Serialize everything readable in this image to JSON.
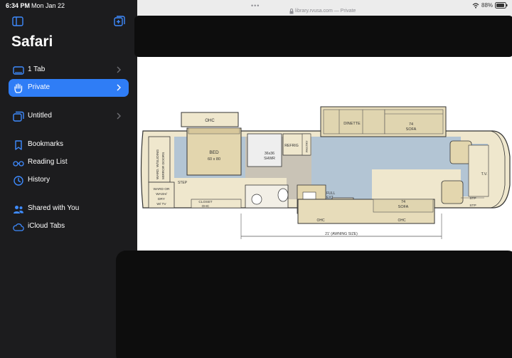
{
  "status": {
    "time": "6:34 PM",
    "date": "Mon Jan 22",
    "battery": "88%"
  },
  "sidebar": {
    "title": "Safari",
    "items": [
      {
        "label": "1 Tab",
        "icon": "tablet-icon"
      },
      {
        "label": "Private",
        "icon": "hand-icon"
      },
      {
        "label": "Untitled",
        "icon": "tab-group-icon"
      },
      {
        "label": "Bookmarks",
        "icon": "bookmark-icon"
      },
      {
        "label": "Reading List",
        "icon": "glasses-icon"
      },
      {
        "label": "History",
        "icon": "clock-icon"
      },
      {
        "label": "Shared with You",
        "icon": "people-icon"
      },
      {
        "label": "iCloud Tabs",
        "icon": "cloud-icon"
      }
    ]
  },
  "toolbar": {
    "url": "library.rvusa.com — Private",
    "dots": "•••"
  },
  "floorplan": {
    "ohc_top": "OHC",
    "bed": "BED",
    "bed_size": "60 x 80",
    "ward_mirror": [
      "WARD. W/SLIDING",
      "MIRROR DOORS"
    ],
    "ward_washer": [
      "WARD OR",
      "WASH/",
      "DRY",
      "W/ TV"
    ],
    "step_left": "STEP",
    "closet_ohc": [
      "CLOSET",
      "OHC"
    ],
    "shower": [
      "36x36",
      "SHWR"
    ],
    "refrig": "REFRIG",
    "pantry": "PANTRY",
    "dinette": "DINETTE",
    "sofa_top": [
      "74",
      "SOFA"
    ],
    "sofa_bottom": [
      "74",
      "SOFA"
    ],
    "full_ext": [
      "FULL",
      "EXT"
    ],
    "ohc_mid": "OHC",
    "ohc_right": "OHC",
    "tv": "T.V.",
    "stp1": "STP",
    "stp2": "STP",
    "awning": "21' (AWNING SIZE)"
  }
}
